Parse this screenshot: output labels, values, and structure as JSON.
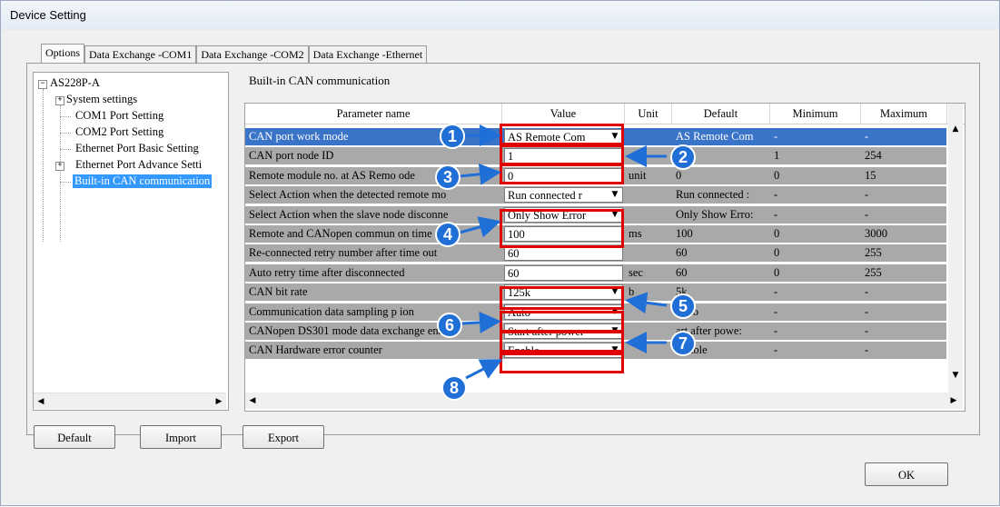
{
  "window": {
    "title": "Device Setting"
  },
  "tabs": [
    "Options",
    "Data Exchange -COM1",
    "Data Exchange -COM2",
    "Data Exchange -Ethernet"
  ],
  "tree": {
    "root": "AS228P-A",
    "items": [
      "System settings",
      "COM1 Port Setting",
      "COM2 Port Setting",
      "Ethernet Port Basic Setting",
      "Ethernet Port Advance Setti",
      "Built-in CAN communication"
    ]
  },
  "section_title": "Built-in CAN communication",
  "grid": {
    "headers": [
      "Parameter name",
      "Value",
      "Unit",
      "Default",
      "Minimum",
      "Maximum"
    ],
    "rows": [
      {
        "name": "CAN port work mode",
        "value": "AS Remote Com",
        "dropdown": true,
        "unit": "",
        "default": "AS Remote Com",
        "min": "-",
        "max": "-"
      },
      {
        "name": "CAN port node ID",
        "value": "1",
        "dropdown": false,
        "unit": "",
        "default": "1",
        "min": "1",
        "max": "254"
      },
      {
        "name": "Remote module no. at AS Remo   ode",
        "value": "0",
        "dropdown": false,
        "unit": "unit",
        "default": "0",
        "min": "0",
        "max": "15"
      },
      {
        "name": "Select Action when the detected remote mo",
        "value": "Run connected r",
        "dropdown": true,
        "unit": "",
        "default": "Run connected :",
        "min": "-",
        "max": "-"
      },
      {
        "name": "Select Action when the slave node disconne",
        "value": "Only Show Error",
        "dropdown": true,
        "unit": "",
        "default": "Only Show Erro:",
        "min": "-",
        "max": "-"
      },
      {
        "name": "Remote and CANopen commun      on time",
        "value": "100",
        "dropdown": false,
        "unit": "ms",
        "default": "100",
        "min": "0",
        "max": "3000"
      },
      {
        "name": "Re-connected retry number after time out",
        "value": "60",
        "dropdown": false,
        "unit": "",
        "default": "60",
        "min": "0",
        "max": "255"
      },
      {
        "name": "Auto retry time after disconnected",
        "value": "60",
        "dropdown": false,
        "unit": "sec",
        "default": "60",
        "min": "0",
        "max": "255"
      },
      {
        "name": "CAN bit rate",
        "value": "125k",
        "dropdown": true,
        "unit": "b",
        "default": "5k",
        "min": "-",
        "max": "-"
      },
      {
        "name": "Communication data sampling p     ion",
        "value": "Auto",
        "dropdown": true,
        "unit": "",
        "default": "Auto",
        "min": "-",
        "max": "-"
      },
      {
        "name": "CANopen DS301 mode data exchange enab",
        "value": "Start after power",
        "dropdown": true,
        "unit": "",
        "default": "art after powe:",
        "min": "-",
        "max": "-"
      },
      {
        "name": "CAN Hardware error counter",
        "value": "Enable",
        "dropdown": true,
        "unit": "",
        "default": "Enable",
        "min": "-",
        "max": "-"
      }
    ]
  },
  "callouts": [
    "1",
    "2",
    "3",
    "4",
    "5",
    "6",
    "7",
    "8"
  ],
  "buttons": {
    "default": "Default",
    "import": "Import",
    "export": "Export",
    "ok": "OK"
  },
  "icons": {
    "dropdown": "chevron-down-icon",
    "expander": "plus-icon",
    "collapser": "minus-icon"
  },
  "colors": {
    "accent": "#3399ff",
    "selected_row": "#3a74c9",
    "row_bg": "#a9a9a9",
    "callout": "#1f6fd6",
    "highlight": "#e00000"
  }
}
